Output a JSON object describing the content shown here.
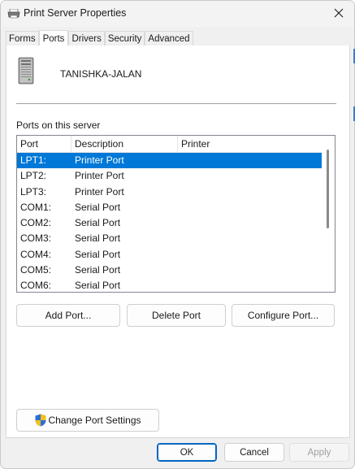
{
  "window": {
    "title": "Print Server Properties"
  },
  "tabs": [
    {
      "label": "Forms",
      "active": false
    },
    {
      "label": "Ports",
      "active": true
    },
    {
      "label": "Drivers",
      "active": false
    },
    {
      "label": "Security",
      "active": false
    },
    {
      "label": "Advanced",
      "active": false
    }
  ],
  "server": {
    "name": "TANISHKA-JALAN",
    "icon": "server-tower-icon"
  },
  "ports_section": {
    "label": "Ports on this server",
    "columns": [
      "Port",
      "Description",
      "Printer"
    ],
    "rows": [
      {
        "port": "LPT1:",
        "description": "Printer Port",
        "printer": "",
        "selected": true
      },
      {
        "port": "LPT2:",
        "description": "Printer Port",
        "printer": "",
        "selected": false
      },
      {
        "port": "LPT3:",
        "description": "Printer Port",
        "printer": "",
        "selected": false
      },
      {
        "port": "COM1:",
        "description": "Serial Port",
        "printer": "",
        "selected": false
      },
      {
        "port": "COM2:",
        "description": "Serial Port",
        "printer": "",
        "selected": false
      },
      {
        "port": "COM3:",
        "description": "Serial Port",
        "printer": "",
        "selected": false
      },
      {
        "port": "COM4:",
        "description": "Serial Port",
        "printer": "",
        "selected": false
      },
      {
        "port": "COM5:",
        "description": "Serial Port",
        "printer": "",
        "selected": false
      },
      {
        "port": "COM6:",
        "description": "Serial Port",
        "printer": "",
        "selected": false
      }
    ]
  },
  "buttons": {
    "add_port": "Add Port...",
    "delete_port": "Delete Port",
    "configure_port": "Configure Port...",
    "change_port_settings": "Change Port Settings",
    "ok": "OK",
    "cancel": "Cancel",
    "apply": "Apply"
  },
  "colors": {
    "selection": "#0078d7",
    "accent": "#0067c0"
  }
}
